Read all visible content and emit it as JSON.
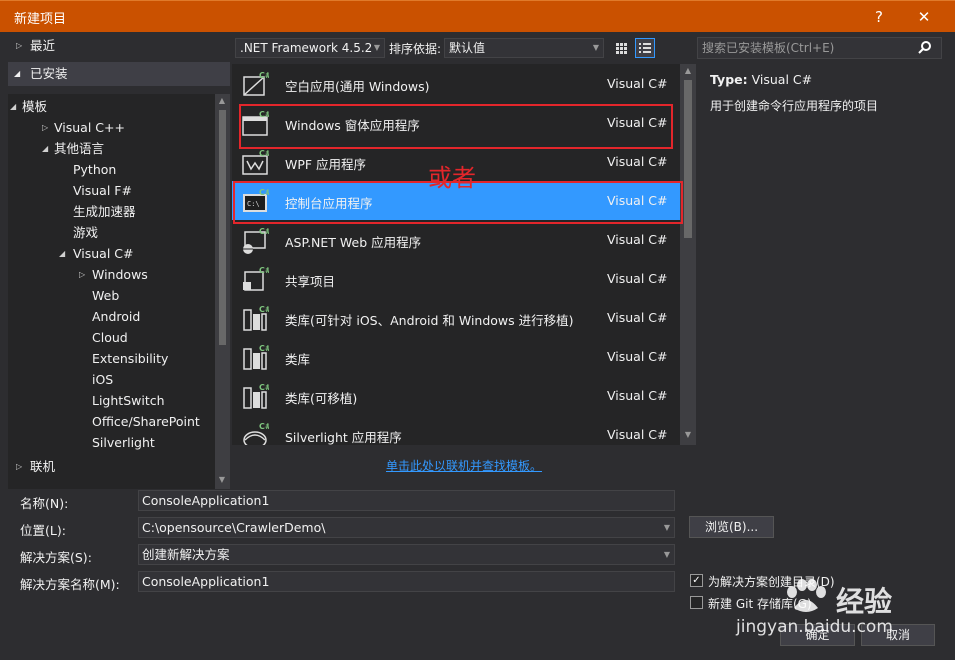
{
  "window": {
    "title": "新建项目",
    "help_glyph": "?",
    "close_glyph": "✕"
  },
  "tree": {
    "recent": "最近",
    "installed": "已安装",
    "templates": "模板",
    "visual_cpp": "Visual C++",
    "other_languages": "其他语言",
    "python": "Python",
    "visual_fsharp": "Visual F#",
    "build_accelerator": "生成加速器",
    "games": "游戏",
    "visual_csharp": "Visual C#",
    "windows": "Windows",
    "web": "Web",
    "android": "Android",
    "cloud": "Cloud",
    "extensibility": "Extensibility",
    "ios": "iOS",
    "lightswitch": "LightSwitch",
    "office_sharepoint": "Office/SharePoint",
    "silverlight": "Silverlight",
    "online": "联机"
  },
  "toolbar": {
    "framework": ".NET Framework 4.5.2",
    "sort_label": "排序依据:",
    "sort_value": "默认值"
  },
  "templates": [
    {
      "name": "空白应用(通用 Windows)",
      "lang": "Visual C#",
      "icon": "blank-app-icon"
    },
    {
      "name": "Windows 窗体应用程序",
      "lang": "Visual C#",
      "icon": "windows-forms-icon"
    },
    {
      "name": "WPF 应用程序",
      "lang": "Visual C#",
      "icon": "wpf-app-icon"
    },
    {
      "name": "控制台应用程序",
      "lang": "Visual C#",
      "icon": "console-app-icon"
    },
    {
      "name": "ASP.NET Web 应用程序",
      "lang": "Visual C#",
      "icon": "aspnet-web-icon"
    },
    {
      "name": "共享项目",
      "lang": "Visual C#",
      "icon": "shared-project-icon"
    },
    {
      "name": "类库(可针对 iOS、Android 和 Windows 进行移植)",
      "lang": "Visual C#",
      "icon": "portable-class-library-icon"
    },
    {
      "name": "类库",
      "lang": "Visual C#",
      "icon": "class-library-icon"
    },
    {
      "name": "类库(可移植)",
      "lang": "Visual C#",
      "icon": "portable-library-icon"
    },
    {
      "name": "Silverlight 应用程序",
      "lang": "Visual C#",
      "icon": "silverlight-app-icon"
    }
  ],
  "annotation": "或者",
  "online_link": "单击此处以联机并查找模板。",
  "search": {
    "placeholder": "搜索已安装模板(Ctrl+E)"
  },
  "info": {
    "type_label": "Type:",
    "type_value": "Visual C#",
    "description": "用于创建命令行应用程序的项目"
  },
  "form": {
    "name_label": "名称(N):",
    "name_value": "ConsoleApplication1",
    "location_label": "位置(L):",
    "location_value": "C:\\opensource\\CrawlerDemo\\",
    "browse": "浏览(B)...",
    "solution_label": "解决方案(S):",
    "solution_value": "创建新解决方案",
    "solution_name_label": "解决方案名称(M):",
    "solution_name_value": "ConsoleApplication1",
    "create_dir_label": "为解决方案创建目录(D)",
    "create_dir_checked": true,
    "new_git_label": "新建 Git 存储库(G)",
    "new_git_checked": false,
    "ok": "确定",
    "cancel": "取消"
  },
  "watermark": {
    "brand": "经验",
    "url": "jingyan.baidu.com"
  },
  "colors": {
    "titlebar": "#ca5100",
    "selection": "#3399ff",
    "annotation": "#e3262b",
    "background": "#2d2d30"
  }
}
